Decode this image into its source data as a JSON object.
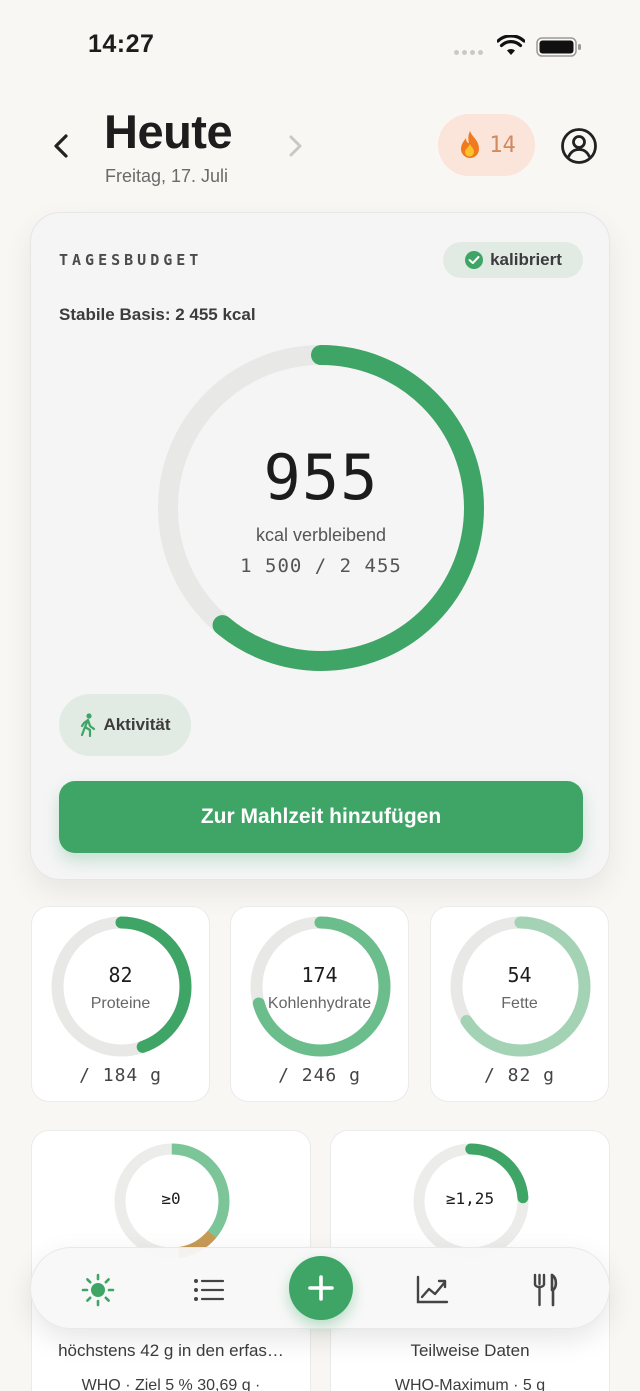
{
  "status_bar": {
    "time": "14:27"
  },
  "header": {
    "title": "Heute",
    "date": "Freitag, 17. Juli",
    "streak_count": "14"
  },
  "budget_card": {
    "label": "TAGESBUDGET",
    "calibration_badge": "kalibriert",
    "base_text": "Stabile Basis: 2 455 kcal",
    "remaining_value": "955",
    "remaining_caption": "kcal verbleibend",
    "progress_text": "1 500 / 2 455",
    "consumed_kcal": 1500,
    "budget_kcal": 2455,
    "activity_label": "Aktivität",
    "add_button_label": "Zur Mahlzeit hinzufügen"
  },
  "macros": [
    {
      "value": "82",
      "name": "Proteine",
      "target": "/ 184 g",
      "fraction": 0.446,
      "color": "#3ea566"
    },
    {
      "value": "174",
      "name": "Kohlenhydrate",
      "target": "/ 246 g",
      "fraction": 0.707,
      "color": "#6bbd8c"
    },
    {
      "value": "54",
      "name": "Fette",
      "target": "/ 82 g",
      "fraction": 0.659,
      "color": "#a3d3b4"
    }
  ],
  "lower_cards": [
    {
      "ring_label": "≥0",
      "caption": "höchstens 42 g in den erfas…",
      "sub": "WHO · Ziel 5 % 30,69 g ·"
    },
    {
      "ring_label": "≥1,25",
      "caption": "Teilweise Daten",
      "sub": "WHO-Maximum · 5 g"
    }
  ],
  "colors": {
    "accent": "#3ea566",
    "track": "#e8e8e6",
    "streak_bg": "#fbe4da",
    "streak_text": "#d18a60",
    "sugar_brown": "#c79a55"
  },
  "tab_bar": {
    "icons": [
      "sun-icon",
      "list-icon",
      "plus-icon",
      "chart-icon",
      "fork-knife-icon"
    ]
  }
}
